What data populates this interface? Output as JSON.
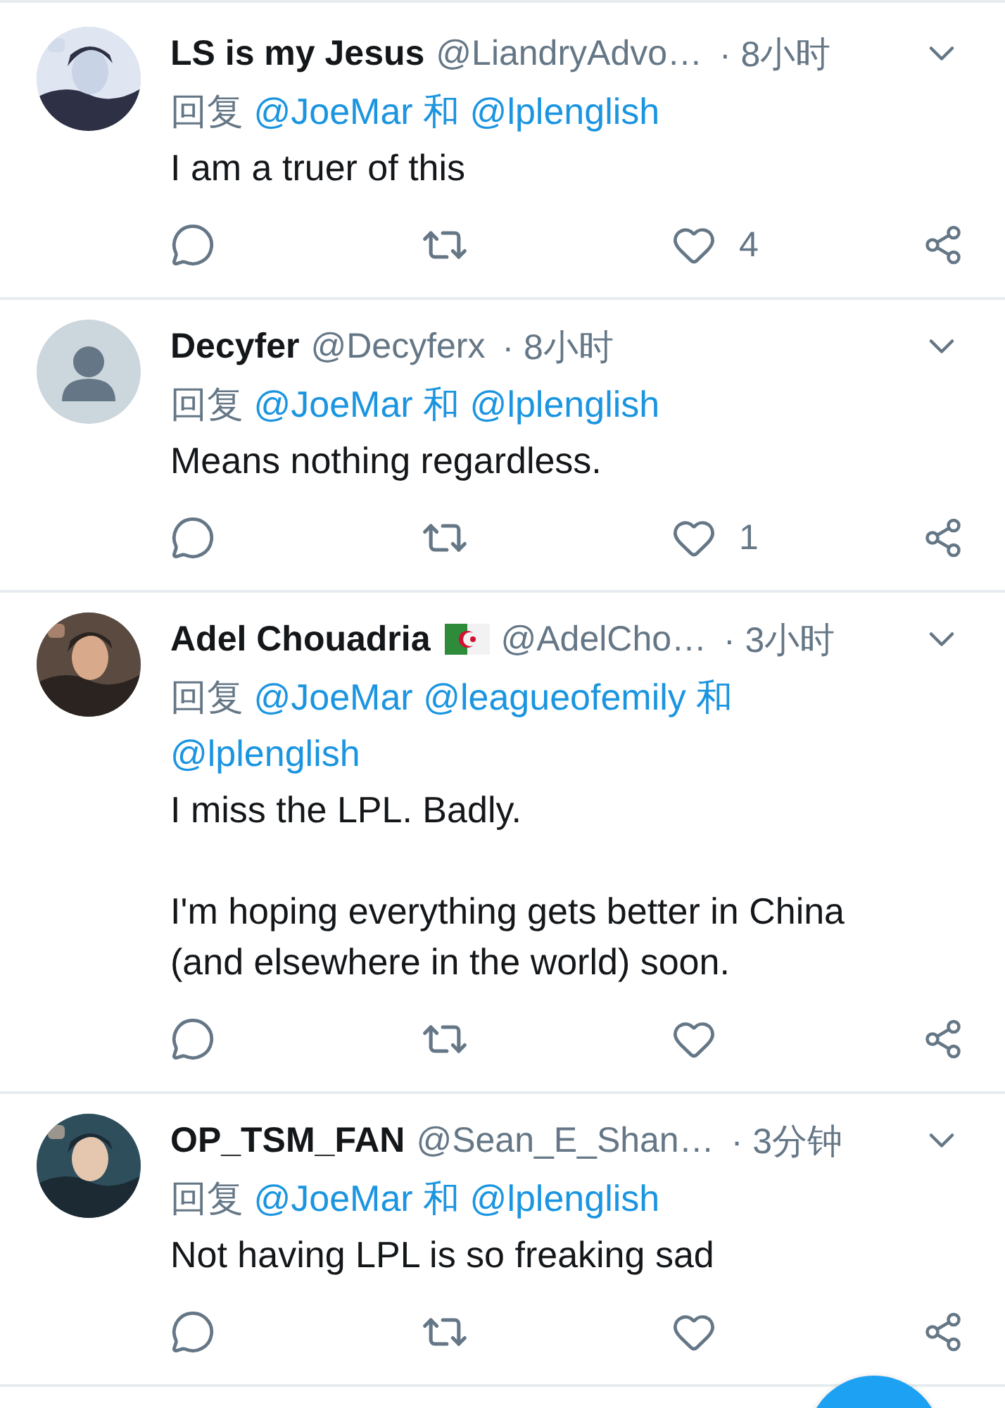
{
  "tweets": [
    {
      "avatar": {
        "kind": "picture"
      },
      "name": "LS is my Jesus",
      "handle": "@LiandryAdvo…",
      "time": "· 8小时",
      "reply_label": "回复",
      "mentions": [
        "@JoeMar",
        "@lplenglish"
      ],
      "conjunction": "和",
      "body": [
        "I am a truer of this"
      ],
      "like_count": "4"
    },
    {
      "avatar": {
        "kind": "default"
      },
      "name": "Decyfer",
      "handle": "@Decyferx",
      "time": "· 8小时",
      "reply_label": "回复",
      "mentions": [
        "@JoeMar",
        "@lplenglish"
      ],
      "conjunction": "和",
      "body": [
        "Means nothing regardless."
      ],
      "like_count": "1"
    },
    {
      "avatar": {
        "kind": "picture"
      },
      "name": "Adel Chouadria",
      "flag": true,
      "handle": "@AdelCho…",
      "time": "· 3小时",
      "reply_label": "回复",
      "mentions": [
        "@JoeMar",
        "@leagueofemily",
        "@lplenglish"
      ],
      "conjunction": "和",
      "body": [
        "I miss the LPL. Badly.",
        "I'm hoping everything gets better in China (and elsewhere in the world) soon."
      ]
    },
    {
      "avatar": {
        "kind": "picture"
      },
      "name": "OP_TSM_FAN",
      "handle": "@Sean_E_Shan…",
      "time": "· 3分钟",
      "reply_label": "回复",
      "mentions": [
        "@JoeMar",
        "@lplenglish"
      ],
      "conjunction": "和",
      "body": [
        "Not having LPL is so freaking sad"
      ]
    }
  ]
}
